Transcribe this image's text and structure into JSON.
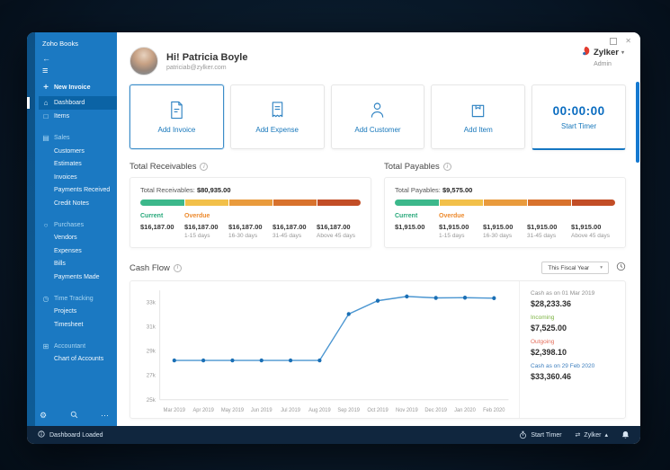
{
  "icons": {
    "back": "←",
    "menu": "≡",
    "plus": "+",
    "home": "⌂",
    "box": "□",
    "document": "▤",
    "cart": "○",
    "clock": "◷",
    "calculator": "⊞",
    "ellipsis": "⋯",
    "gear": "⚙",
    "caret_down": "▾",
    "caret_up": "▴",
    "swap": "⇄",
    "close": "✕",
    "info": "i"
  },
  "sidebar": {
    "title": "Zoho Books",
    "nav": [
      {
        "label": "New Invoice",
        "icon": "plus",
        "style": "action"
      },
      {
        "label": "Dashboard",
        "icon": "home",
        "active": true
      },
      {
        "label": "Items",
        "icon": "box"
      },
      {
        "label": "Sales",
        "icon": "document",
        "style": "section"
      },
      {
        "label": "Customers",
        "style": "sub"
      },
      {
        "label": "Estimates",
        "style": "sub"
      },
      {
        "label": "Invoices",
        "style": "sub"
      },
      {
        "label": "Payments Received",
        "style": "sub"
      },
      {
        "label": "Credit Notes",
        "style": "sub"
      },
      {
        "label": "Purchases",
        "icon": "cart",
        "style": "section"
      },
      {
        "label": "Vendors",
        "style": "sub"
      },
      {
        "label": "Expenses",
        "style": "sub"
      },
      {
        "label": "Bills",
        "style": "sub"
      },
      {
        "label": "Payments Made",
        "style": "sub"
      },
      {
        "label": "Time Tracking",
        "icon": "clock",
        "style": "section"
      },
      {
        "label": "Projects",
        "style": "sub"
      },
      {
        "label": "Timesheet",
        "style": "sub"
      },
      {
        "label": "Accountant",
        "icon": "calculator",
        "style": "section"
      },
      {
        "label": "Chart of Accounts",
        "style": "sub"
      }
    ]
  },
  "header": {
    "greeting": "Hi! Patricia Boyle",
    "email": "patriciab@zylker.com",
    "org_name": "Zylker",
    "org_role": "Admin"
  },
  "quick_actions": [
    {
      "label": "Add Invoice",
      "icon": "invoice",
      "selected": true
    },
    {
      "label": "Add Expense",
      "icon": "expense"
    },
    {
      "label": "Add Customer",
      "icon": "customer"
    },
    {
      "label": "Add Item",
      "icon": "item"
    }
  ],
  "timer": {
    "time": "00:00:00",
    "label": "Start Timer"
  },
  "receivables": {
    "section_title": "Total Receivables",
    "total_label": "Total Receivables:",
    "total_amount": "$80,935.00",
    "current_label": "Current",
    "current_amount": "$16,187.00",
    "overdue_label": "Overdue",
    "aging": [
      {
        "amount": "$16,187.00",
        "range": "1-15 days"
      },
      {
        "amount": "$16,187.00",
        "range": "16-30 days"
      },
      {
        "amount": "$16,187.00",
        "range": "31-45 days"
      },
      {
        "amount": "$16,187.00",
        "range": "Above 45 days"
      }
    ],
    "bar_segments": [
      {
        "color": "#3cb88b",
        "pct": 20
      },
      {
        "color": "#f2c04a",
        "pct": 20
      },
      {
        "color": "#e99b3d",
        "pct": 20
      },
      {
        "color": "#d8722d",
        "pct": 20
      },
      {
        "color": "#c24d26",
        "pct": 20
      }
    ]
  },
  "payables": {
    "section_title": "Total Payables",
    "total_label": "Total Payables:",
    "total_amount": "$9,575.00",
    "current_label": "Current",
    "current_amount": "$1,915.00",
    "overdue_label": "Overdue",
    "aging": [
      {
        "amount": "$1,915.00",
        "range": "1-15 days"
      },
      {
        "amount": "$1,915.00",
        "range": "16-30 days"
      },
      {
        "amount": "$1,915.00",
        "range": "31-45 days"
      },
      {
        "amount": "$1,915.00",
        "range": "Above 45 days"
      }
    ],
    "bar_segments": [
      {
        "color": "#3cb88b",
        "pct": 20
      },
      {
        "color": "#f2c04a",
        "pct": 20
      },
      {
        "color": "#e99b3d",
        "pct": 20
      },
      {
        "color": "#d8722d",
        "pct": 20
      },
      {
        "color": "#c24d26",
        "pct": 20
      }
    ]
  },
  "cashflow": {
    "section_title": "Cash Flow",
    "filter": "This Fiscal Year",
    "stats": [
      {
        "label": "Cash as on 01 Mar 2019",
        "value": "$28,233.36",
        "color": "#8f8f8f"
      },
      {
        "label": "Incoming",
        "value": "$7,525.00",
        "color": "#7cb342"
      },
      {
        "label": "Outgoing",
        "value": "$2,398.10",
        "color": "#e4705e"
      },
      {
        "label": "Cash as on 29 Feb 2020",
        "value": "$33,360.46",
        "color": "#3e7fbe"
      }
    ]
  },
  "chart_data": {
    "type": "line",
    "title": "Cash Flow",
    "x": [
      "Mar 2019",
      "Apr 2019",
      "May 2019",
      "Jun 2019",
      "Jul 2019",
      "Aug 2019",
      "Sep 2019",
      "Oct 2019",
      "Nov 2019",
      "Dec 2019",
      "Jan 2020",
      "Feb 2020"
    ],
    "series": [
      {
        "name": "Cash",
        "values": [
          28233.36,
          28233.36,
          28233.36,
          28233.36,
          28233.36,
          28233.36,
          32050,
          33150,
          33500,
          33380,
          33400,
          33360.46
        ]
      }
    ],
    "ylim": [
      25000,
      34000
    ],
    "yticks": [
      {
        "v": 25000,
        "label": "25k"
      },
      {
        "v": 27000,
        "label": "27k"
      },
      {
        "v": 29000,
        "label": "29k"
      },
      {
        "v": 31000,
        "label": "31k"
      },
      {
        "v": 33000,
        "label": "33k"
      }
    ],
    "grid": false,
    "legend": "none",
    "line_color": "#4b96d1",
    "point_color": "#1a6fb5"
  },
  "statusbar": {
    "status": "Dashboard Loaded",
    "timer": "Start Timer",
    "org": "Zylker"
  }
}
